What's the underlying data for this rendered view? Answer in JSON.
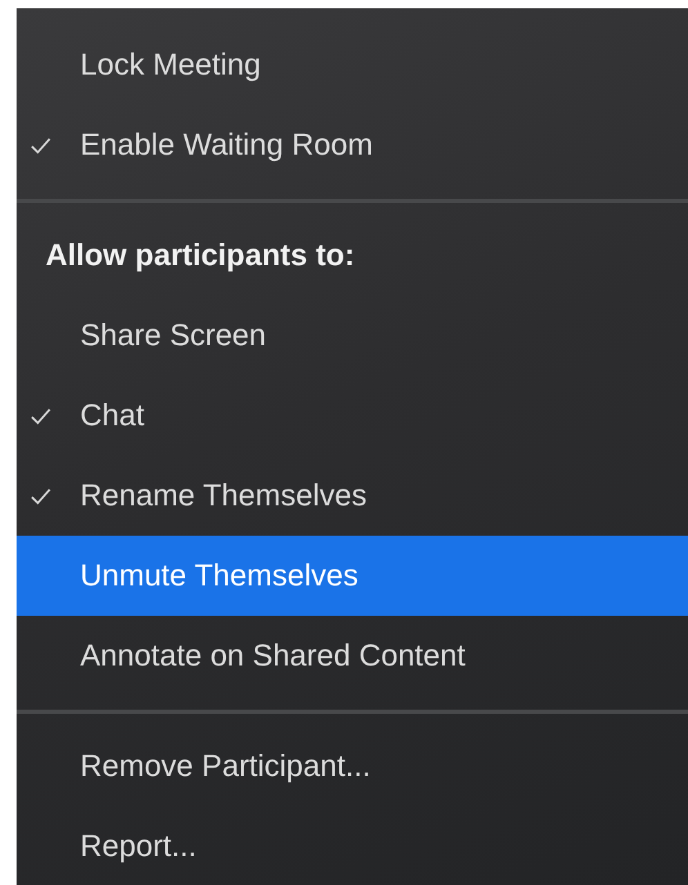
{
  "menu": {
    "items": [
      {
        "kind": "item",
        "label": "Lock Meeting",
        "checked": false,
        "selected": false
      },
      {
        "kind": "item",
        "label": "Enable Waiting Room",
        "checked": true,
        "selected": false
      },
      {
        "kind": "separator"
      },
      {
        "kind": "header",
        "label": "Allow participants to:"
      },
      {
        "kind": "item",
        "label": "Share Screen",
        "checked": false,
        "selected": false
      },
      {
        "kind": "item",
        "label": "Chat",
        "checked": true,
        "selected": false
      },
      {
        "kind": "item",
        "label": "Rename Themselves",
        "checked": true,
        "selected": false
      },
      {
        "kind": "item",
        "label": "Unmute Themselves",
        "checked": false,
        "selected": true
      },
      {
        "kind": "item",
        "label": "Annotate on Shared Content",
        "checked": false,
        "selected": false
      },
      {
        "kind": "separator"
      },
      {
        "kind": "item",
        "label": "Remove Participant...",
        "checked": false,
        "selected": false
      },
      {
        "kind": "item",
        "label": "Report...",
        "checked": false,
        "selected": false
      }
    ]
  }
}
